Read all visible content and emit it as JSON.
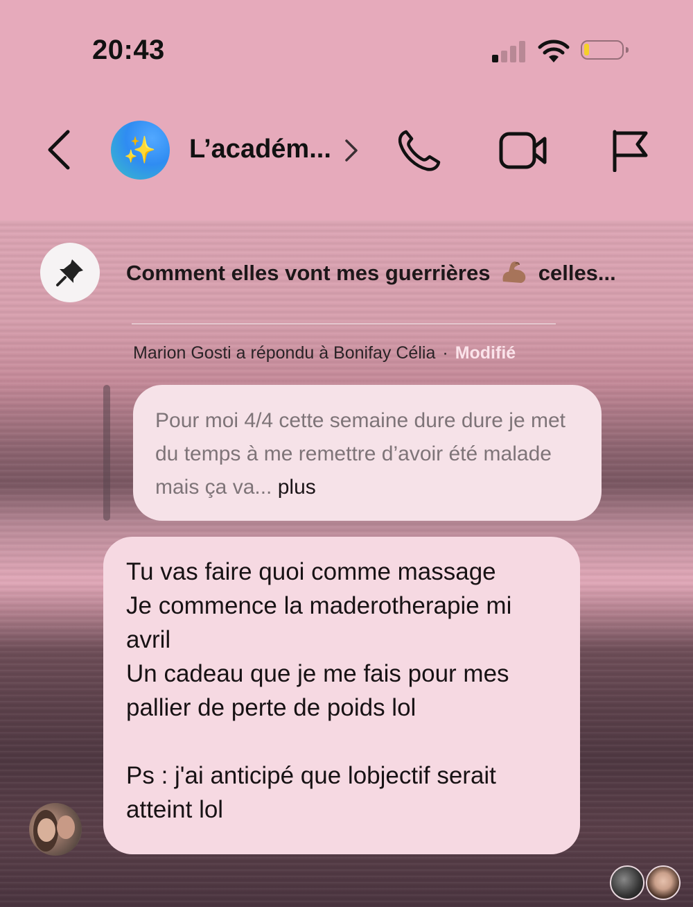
{
  "status_bar": {
    "time": "20:43"
  },
  "header": {
    "title": "L’académ...",
    "avatar_icon": "sparkles-icon"
  },
  "pinned": {
    "text_before": "Comment elles vont mes guerrières",
    "emoji": "flexed-biceps",
    "text_after": "celles..."
  },
  "reply_meta": {
    "text": "Marion Gosti a répondu à Bonifay Célia",
    "separator": "·",
    "edited_label": "Modifié"
  },
  "quoted_message": {
    "text": "Pour moi 4/4 cette semaine dure dure je met du temps à me remettre d’avoir été malade mais ça va...",
    "more_label": "plus"
  },
  "message": {
    "text": "Tu vas faire quoi comme massage\nJe commence la maderotherapie mi avril\nUn cadeau que je me fais pour mes pallier de perte de poids lol\n\nPs : j'ai anticipé que lobjectif serait atteint lol"
  },
  "colors": {
    "header_bg": "#e6aabb",
    "bubble_bg": "#f6d9e2",
    "quoted_bubble_bg": "#f6e2e8",
    "battery_fill": "#f5d02a"
  }
}
